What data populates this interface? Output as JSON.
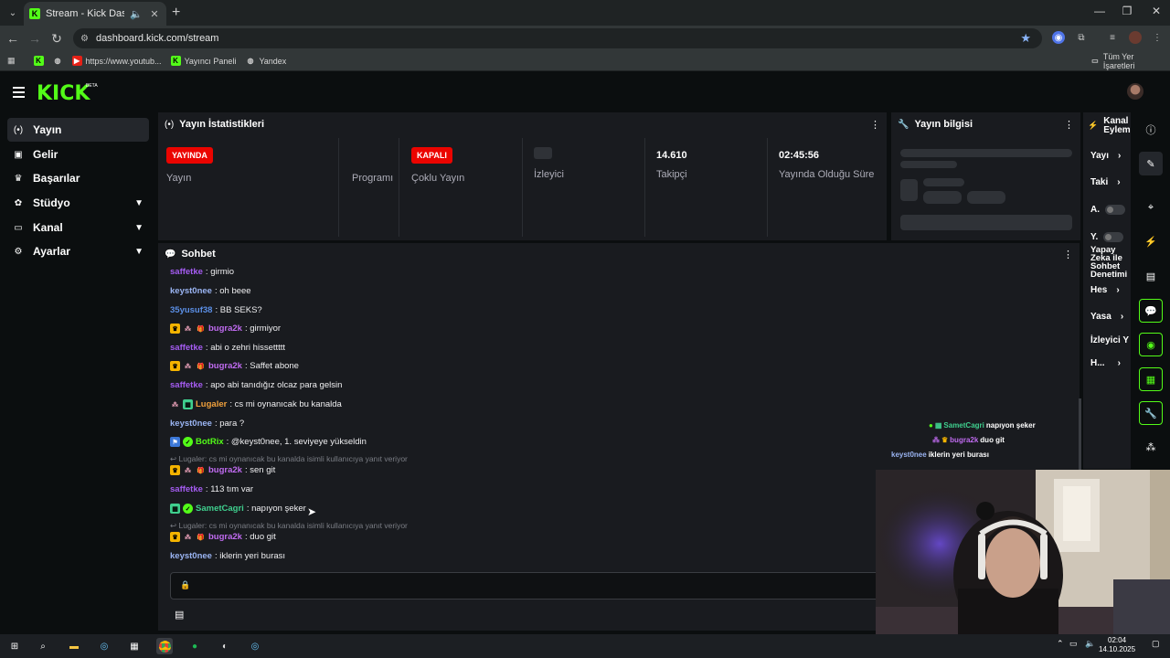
{
  "browser": {
    "tab_title": "Stream - Kick Dashboard",
    "url": "dashboard.kick.com/stream",
    "bookmarks": [
      {
        "label": "https://www.youtub..."
      },
      {
        "label": "Yayıncı Paneli"
      },
      {
        "label": "Yandex"
      }
    ],
    "all_bookmarks": "Tüm Yer İşaretleri"
  },
  "header": {
    "logo": "KICK",
    "beta": "BETA"
  },
  "sidebar": {
    "items": [
      {
        "label": "Yayın",
        "icon": "broadcast-icon"
      },
      {
        "label": "Gelir",
        "icon": "wallet-icon"
      },
      {
        "label": "Başarılar",
        "icon": "trophy-icon"
      },
      {
        "label": "Stüdyo",
        "icon": "palette-icon"
      },
      {
        "label": "Kanal",
        "icon": "tv-icon"
      },
      {
        "label": "Ayarlar",
        "icon": "gear-icon"
      }
    ]
  },
  "stats": {
    "title": "Yayın İstatistikleri",
    "live_badge": "YAYINDA",
    "live_label": "Yayın",
    "program_label": "Programı",
    "multi_badge": "KAPALI",
    "multi_label": "Çoklu Yayın",
    "viewers_label": "İzleyici",
    "followers_value": "14.610",
    "followers_label": "Takipçi",
    "uptime_value": "02:45:56",
    "uptime_label": "Yayında Olduğu Süre"
  },
  "stream_info": {
    "title": "Yayın bilgisi"
  },
  "channel_actions": {
    "title": "Kanal Eylemleri",
    "rows": [
      {
        "label": "Yayı"
      },
      {
        "label": "Taki"
      },
      {
        "label": "A."
      },
      {
        "label": "Y."
      },
      {
        "label": "Yapay Zeka ile Sohbet Denetimi"
      },
      {
        "label": "Hes"
      },
      {
        "label": "Yasa"
      },
      {
        "label": "İzleyici Y"
      },
      {
        "label": "H..."
      }
    ]
  },
  "chat": {
    "title": "Sohbet",
    "messages": [
      {
        "user": "saffetke",
        "text": ": girmio"
      },
      {
        "user": "keyst0nee",
        "text": ": oh beee"
      },
      {
        "user": "35yusuf38",
        "text": ": BB SEKS?"
      },
      {
        "user": "bugra2k",
        "text": ": girmiyor"
      },
      {
        "user": "saffetke",
        "text": ": abi o zehri hissettttt"
      },
      {
        "user": "bugra2k",
        "text": ": Saffet abone"
      },
      {
        "user": "saffetke",
        "text": ": apo abi tanıdığız olcaz para gelsin"
      },
      {
        "user": "Lugaler",
        "text": ": cs mi oynanıcak bu kanalda"
      },
      {
        "user": "keyst0nee",
        "text": ": para ?"
      },
      {
        "user": "BotRix",
        "text": ": @keyst0nee, 1. seviyeye yükseldin"
      },
      {
        "reply": "Lugaler: cs mi oynanıcak bu kanalda isimli kullanıcıya yanıt veriyor"
      },
      {
        "user": "bugra2k",
        "text": ": sen git"
      },
      {
        "user": "saffetke",
        "text": ": 113 tım var"
      },
      {
        "user": "SametCagri",
        "text": ": napıyon şeker"
      },
      {
        "reply": "Lugaler: cs mi oynanıcak bu kanalda isimli kullanıcıya yanıt veriyor"
      },
      {
        "user": "bugra2k",
        "text": ": duo git"
      },
      {
        "user": "keyst0nee",
        "text": ": iklerin yeri burası"
      }
    ],
    "overlay": [
      {
        "user": "SametCagri",
        "text": "napıyon şeker"
      },
      {
        "user": "bugra2k",
        "text": "duo git"
      },
      {
        "user": "keyst0nee",
        "text": "iklerin yeri burası"
      }
    ]
  },
  "taskbar": {
    "time": "02:04",
    "date": "14.10.2025"
  },
  "colors": {
    "accent": "#53fc18",
    "live": "#eb0400",
    "panel": "#191b1f",
    "bg": "#0b0e0f"
  }
}
